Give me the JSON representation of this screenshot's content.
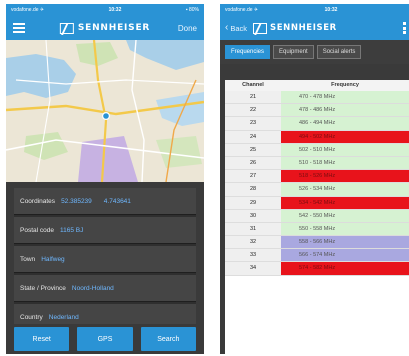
{
  "colors": {
    "accent": "#2a93d5",
    "free": "#d6f2d2",
    "busy": "#e8131b",
    "reserved": "#a9a8e0"
  },
  "left": {
    "status": {
      "carrier": "vodafone.de ✈",
      "time": "10:32",
      "battery": "▪ 80%"
    },
    "header": {
      "menu_icon": "hamburger-icon",
      "brand": "SENNHEISER",
      "done_label": "Done"
    },
    "info": {
      "coordinates_label": "Coordinates",
      "latitude": "52.385239",
      "longitude": "4.743641",
      "postal_label": "Postal code",
      "postal_value": "1165 BJ",
      "town_label": "Town",
      "town_value": "Halfweg",
      "state_label": "State / Province",
      "state_value": "Noord-Holland",
      "country_label": "Country",
      "country_value": "Nederland"
    },
    "buttons": {
      "reset": "Reset",
      "gps": "GPS",
      "search": "Search"
    }
  },
  "right": {
    "status": {
      "carrier": "vodafone.de ✈",
      "time": "10:32"
    },
    "header": {
      "back_label": "Back",
      "brand": "SENNHEISER"
    },
    "tabs": [
      "Frequencies",
      "Equipment",
      "Social alerts"
    ],
    "columns": {
      "channel": "Channel",
      "frequency": "Frequency"
    },
    "rows": [
      {
        "channel": "21",
        "frequency": "470 - 478 MHz",
        "state": "free"
      },
      {
        "channel": "22",
        "frequency": "478 - 486 MHz",
        "state": "free"
      },
      {
        "channel": "23",
        "frequency": "486 - 494 MHz",
        "state": "free"
      },
      {
        "channel": "24",
        "frequency": "494 - 502 MHz",
        "state": "busy"
      },
      {
        "channel": "25",
        "frequency": "502 - 510 MHz",
        "state": "free"
      },
      {
        "channel": "26",
        "frequency": "510 - 518 MHz",
        "state": "free"
      },
      {
        "channel": "27",
        "frequency": "518 - 526 MHz",
        "state": "busy"
      },
      {
        "channel": "28",
        "frequency": "526 - 534 MHz",
        "state": "free"
      },
      {
        "channel": "29",
        "frequency": "534 - 542 MHz",
        "state": "busy"
      },
      {
        "channel": "30",
        "frequency": "542 - 550 MHz",
        "state": "free"
      },
      {
        "channel": "31",
        "frequency": "550 - 558 MHz",
        "state": "free"
      },
      {
        "channel": "32",
        "frequency": "558 - 566 MHz",
        "state": "reserved"
      },
      {
        "channel": "33",
        "frequency": "566 - 574 MHz",
        "state": "reserved"
      },
      {
        "channel": "34",
        "frequency": "574 - 582 MHz",
        "state": "busy"
      }
    ]
  }
}
